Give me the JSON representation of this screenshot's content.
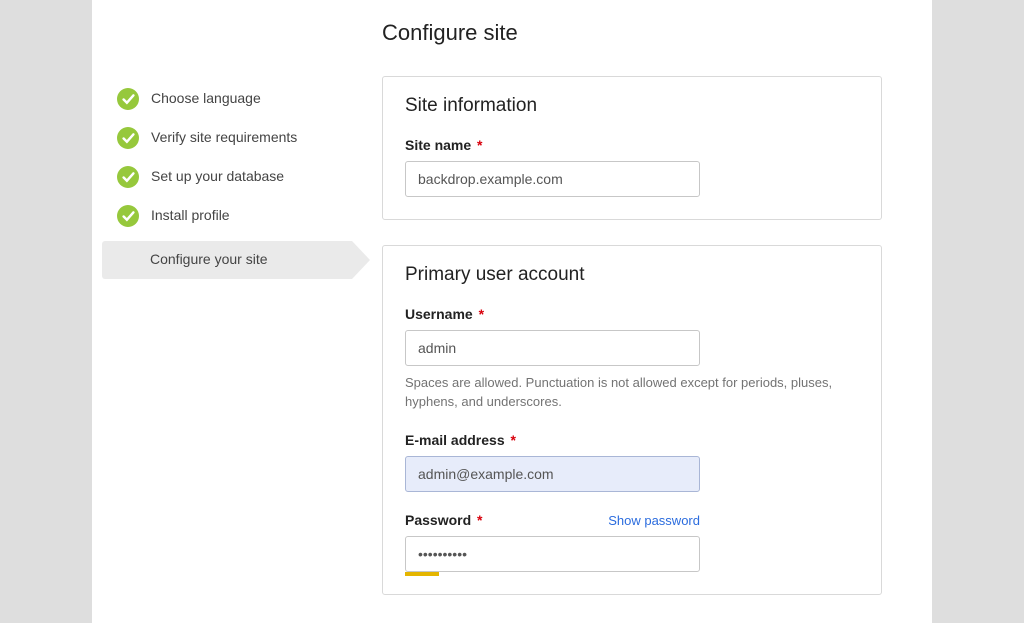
{
  "page_title": "Configure site",
  "steps": {
    "s0": "Choose language",
    "s1": "Verify site requirements",
    "s2": "Set up your database",
    "s3": "Install profile",
    "s4": "Configure your site"
  },
  "site_info": {
    "legend": "Site information",
    "site_name_label": "Site name",
    "site_name_value": "backdrop.example.com"
  },
  "user_account": {
    "legend": "Primary user account",
    "username_label": "Username",
    "username_value": "admin",
    "username_desc": "Spaces are allowed. Punctuation is not allowed except for periods, pluses, hyphens, and underscores.",
    "email_label": "E-mail address",
    "email_value": "admin@example.com",
    "password_label": "Password",
    "show_password": "Show password",
    "password_value": "••••••••••"
  },
  "required_marker": "*"
}
